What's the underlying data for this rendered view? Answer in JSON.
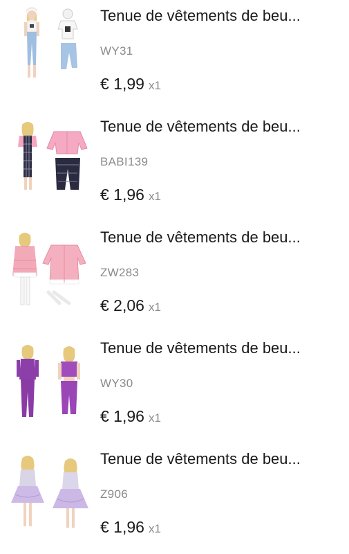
{
  "items": [
    {
      "title": "Tenue de vêtements de beu...",
      "sku": "WY31",
      "price": "€ 1,99",
      "qty": "x1",
      "image_icon": "doll-outfit-white-top-jeans-icon"
    },
    {
      "title": "Tenue de vêtements de beu...",
      "sku": "BABI139",
      "price": "€ 1,96",
      "qty": "x1",
      "image_icon": "doll-outfit-pink-jacket-plaid-icon"
    },
    {
      "title": "Tenue de vêtements de beu...",
      "sku": "ZW283",
      "price": "€ 2,06",
      "qty": "x1",
      "image_icon": "doll-outfit-pink-coat-icon"
    },
    {
      "title": "Tenue de vêtements de beu...",
      "sku": "WY30",
      "price": "€ 1,96",
      "qty": "x1",
      "image_icon": "doll-outfit-purple-tracksuit-icon"
    },
    {
      "title": "Tenue de vêtements de beu...",
      "sku": "Z906",
      "price": "€ 1,96",
      "qty": "x1",
      "image_icon": "doll-outfit-lilac-dress-icon"
    }
  ],
  "colors": {
    "text_primary": "#1a1a1a",
    "text_secondary": "#8a8a8a",
    "background": "#ffffff"
  }
}
